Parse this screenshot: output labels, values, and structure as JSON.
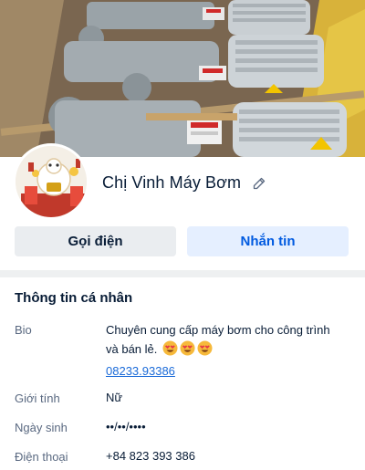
{
  "profile": {
    "name": "Chị Vinh Máy Bơm"
  },
  "actions": {
    "call_label": "Gọi điện",
    "message_label": "Nhắn tin"
  },
  "info": {
    "section_title": "Thông tin cá nhân",
    "bio_label": "Bio",
    "bio_text": "Chuyên cung cấp máy bơm cho công trình và bán lẻ.",
    "bio_link": "08233.93386",
    "gender_label": "Giới tính",
    "gender_value": "Nữ",
    "birthday_label": "Ngày sinh",
    "birthday_value": "••/••/••••",
    "phone_label": "Điện thoại",
    "phone_value": "+84 823 393 386"
  },
  "colors": {
    "message_button_bg": "#e5efff",
    "message_button_text": "#005ae0",
    "call_button_bg": "#eaedf0",
    "link": "#1a6ad8"
  },
  "icons": {
    "edit": "pencil-icon",
    "bio_emoji": "heart-eyes-emoji"
  }
}
